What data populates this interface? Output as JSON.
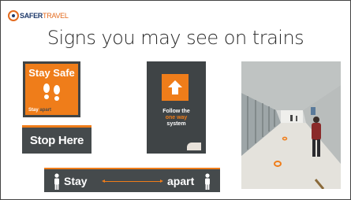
{
  "logo": {
    "brand": "SAFER",
    "suffix": "TRAVEL"
  },
  "title": "Signs you may see on trains",
  "signs": {
    "stay_safe": {
      "heading": "Stay Safe",
      "footer_a": "Stay",
      "footer_b": "apart"
    },
    "stop_here": {
      "label": "Stop Here"
    },
    "one_way": {
      "line1": "Follow the",
      "line2": "one way",
      "line3": "system"
    },
    "stay_apart": {
      "left": "Stay",
      "right": "apart"
    }
  },
  "colors": {
    "orange": "#ef7d1a",
    "dark": "#454a4c"
  }
}
